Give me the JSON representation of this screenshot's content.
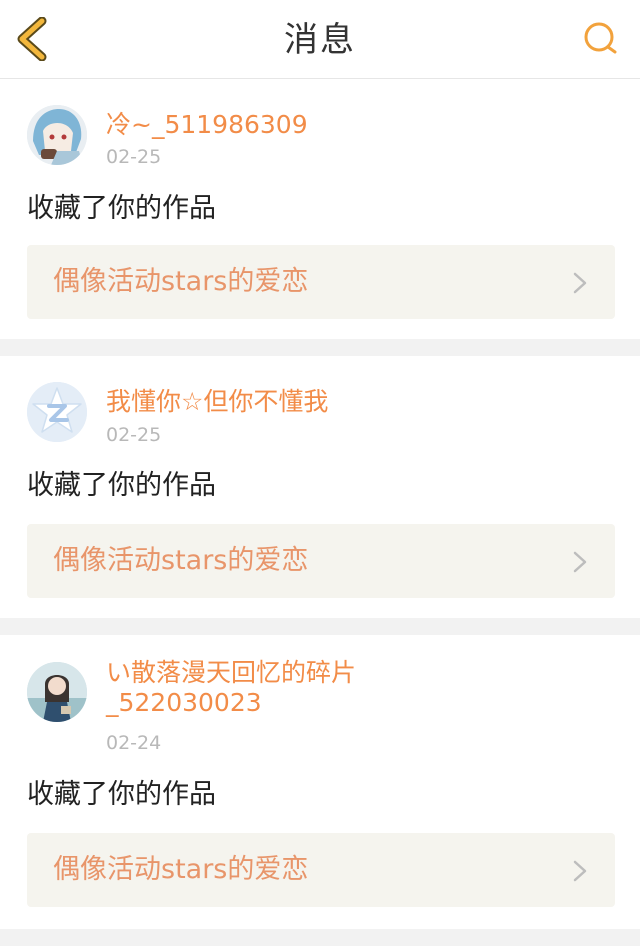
{
  "header": {
    "title": "消息",
    "back_icon": "chevron-left-icon",
    "search_icon": "search-icon",
    "accent_color": "#f2a23c"
  },
  "notifications": [
    {
      "username": "冷~_511986309",
      "date": "02-25",
      "action": "收藏了你的作品",
      "work_title": "偶像活动stars的爱恋"
    },
    {
      "username": "我懂你☆但你不懂我",
      "date": "02-25",
      "action": "收藏了你的作品",
      "work_title": "偶像活动stars的爱恋"
    },
    {
      "username": "い散落漫天回忆的碎片",
      "username_line2": "_522030023",
      "date": "02-24",
      "action": "收藏了你的作品",
      "work_title": "偶像活动stars的爱恋"
    }
  ],
  "colors": {
    "username": "#f28c48",
    "work_title": "#e8956a",
    "date": "#b8b8b8",
    "card_bg": "#f5f4ee",
    "separator": "#f2f2f2"
  }
}
